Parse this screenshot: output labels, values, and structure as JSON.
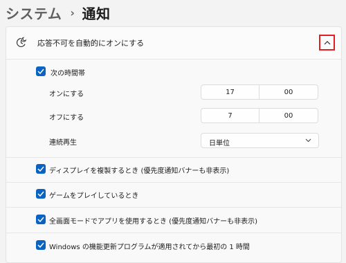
{
  "breadcrumb": {
    "parent": "システム",
    "separator": "›",
    "current": "通知"
  },
  "dnd": {
    "label": "応答不可を自動的にオンにする"
  },
  "schedule": {
    "label": "次の時間帯",
    "on_label": "オンにする",
    "on_hour": "17",
    "on_minute": "00",
    "off_label": "オフにする",
    "off_hour": "7",
    "off_minute": "00",
    "repeat_label": "連続再生",
    "repeat_value": "日単位"
  },
  "options": [
    {
      "label": "ディスプレイを複製するとき (優先度通知バナーも非表示)",
      "checked": true
    },
    {
      "label": "ゲームをプレイしているとき",
      "checked": true
    },
    {
      "label": "全画面モードでアプリを使用するとき (優先度通知バナーも非表示)",
      "checked": true
    },
    {
      "label": "Windows の機能更新プログラムが適用されてから最初の 1 時間",
      "checked": true
    }
  ],
  "colors": {
    "accent": "#0a63c1",
    "highlight_box": "#e02020"
  },
  "icons": {
    "header": "clock-moon-icon",
    "expand": "chevron-up-icon",
    "dropdown": "chevron-down-icon",
    "check": "checkmark-icon"
  }
}
